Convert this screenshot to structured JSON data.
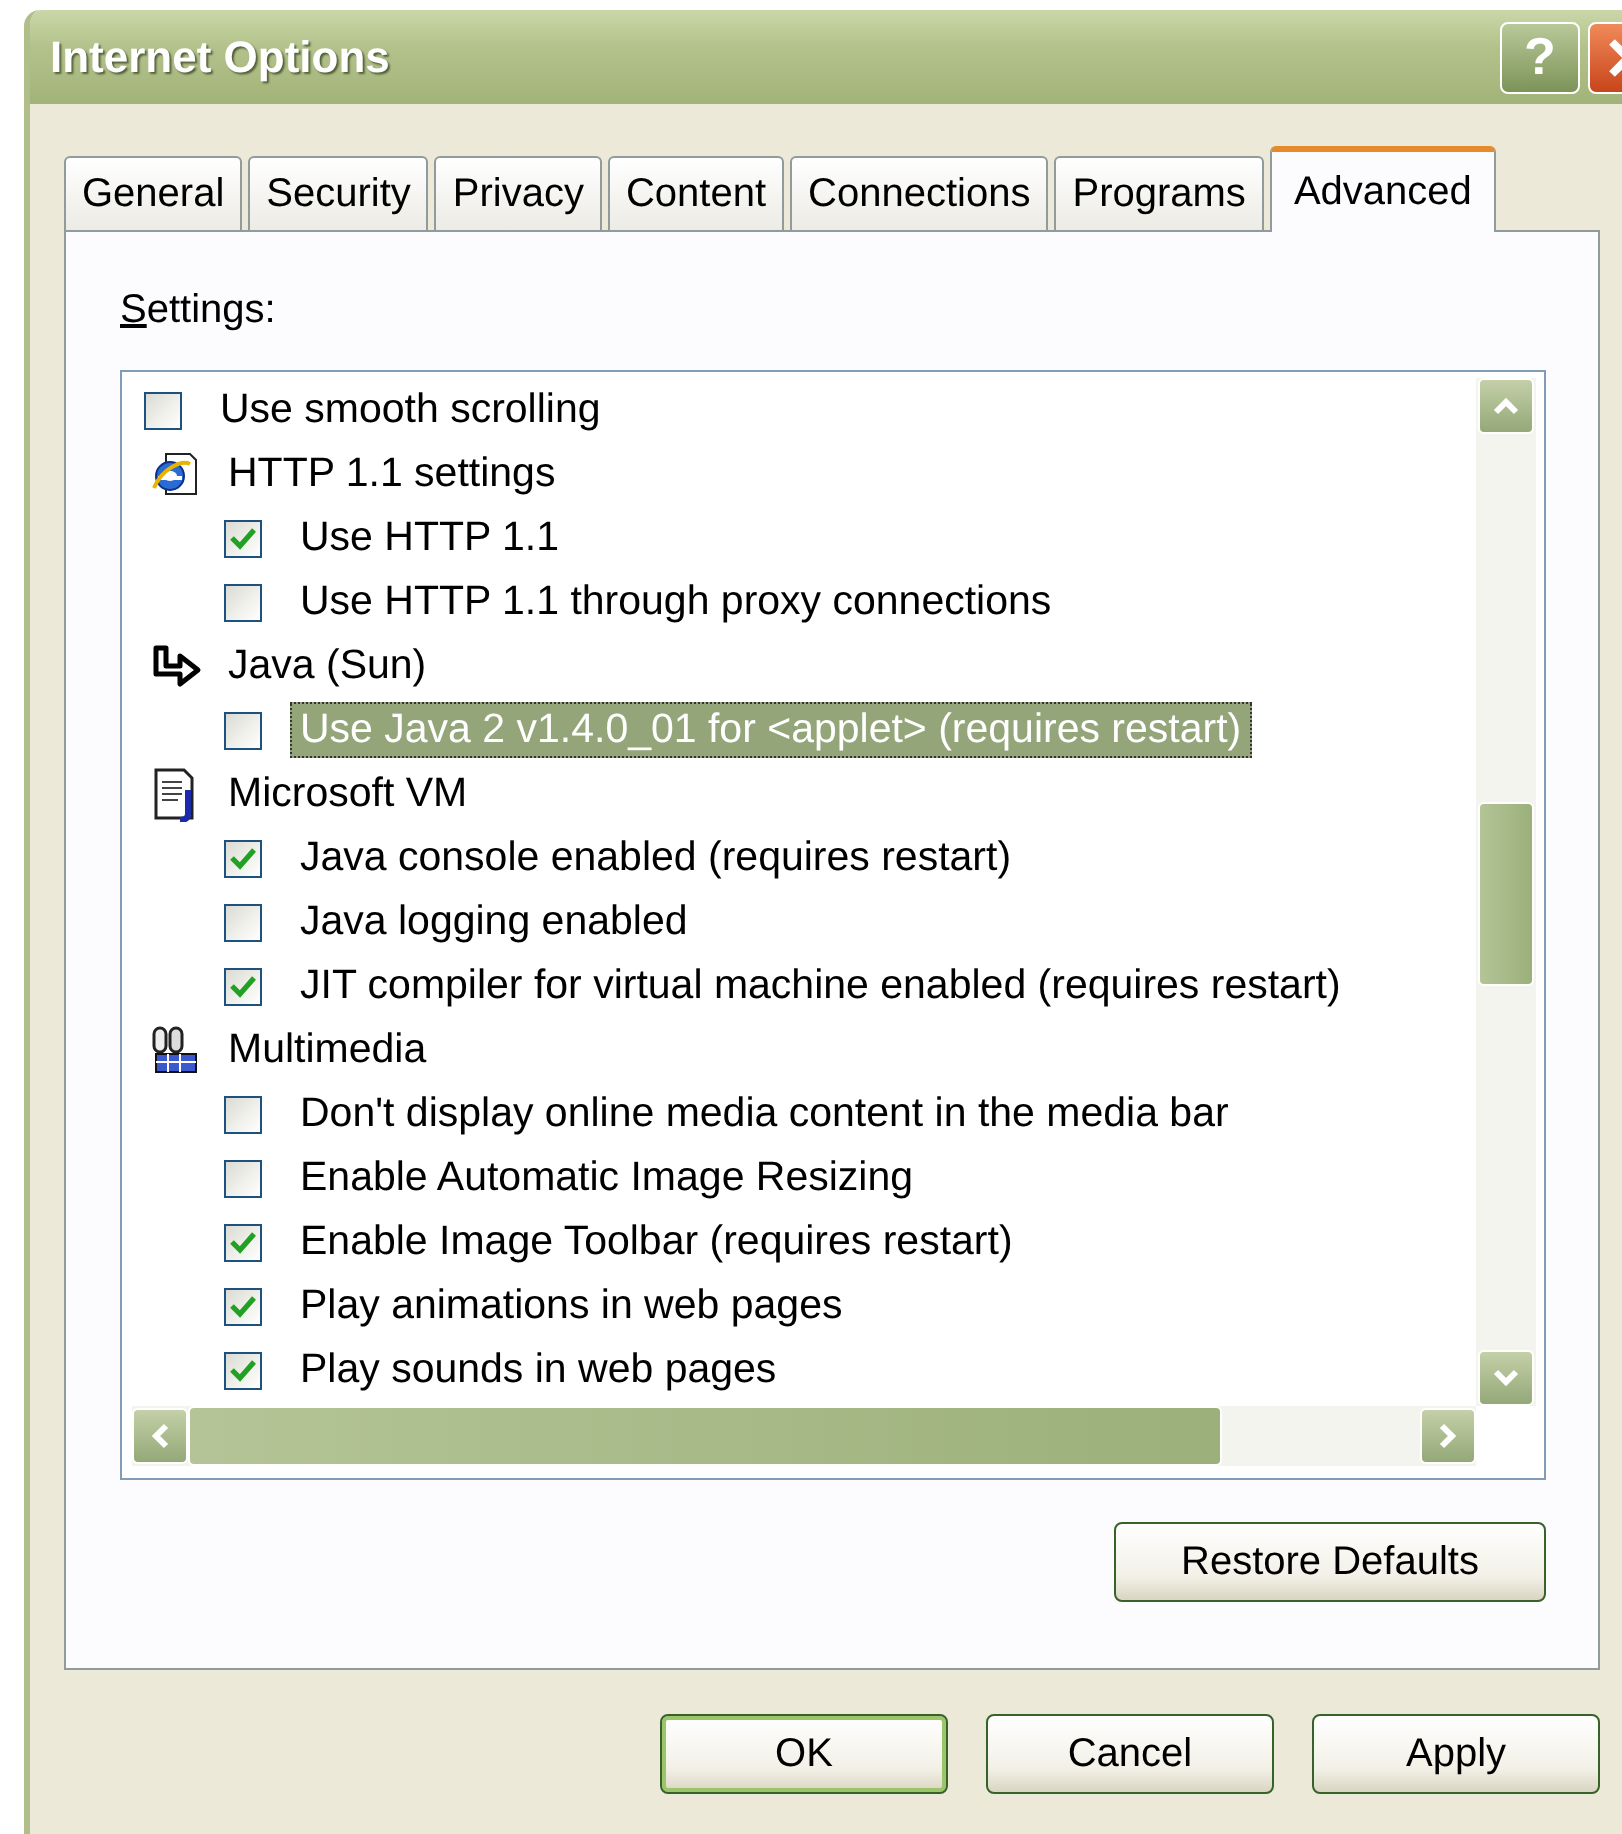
{
  "window": {
    "title": "Internet Options",
    "help_button": "?"
  },
  "tabs": [
    {
      "label": "General",
      "selected": false
    },
    {
      "label": "Security",
      "selected": false
    },
    {
      "label": "Privacy",
      "selected": false
    },
    {
      "label": "Content",
      "selected": false
    },
    {
      "label": "Connections",
      "selected": false
    },
    {
      "label": "Programs",
      "selected": false
    },
    {
      "label": "Advanced",
      "selected": true
    }
  ],
  "settings_label": "Settings:",
  "settings": [
    {
      "kind": "checkbox",
      "label": "Use smooth scrolling",
      "checked": false,
      "selected": false
    },
    {
      "kind": "group",
      "label": "HTTP 1.1 settings",
      "children": [
        {
          "kind": "checkbox",
          "label": "Use HTTP 1.1",
          "checked": true,
          "selected": false
        },
        {
          "kind": "checkbox",
          "label": "Use HTTP 1.1 through proxy connections",
          "checked": false,
          "selected": false
        }
      ]
    },
    {
      "kind": "group",
      "label": "Java (Sun)",
      "children": [
        {
          "kind": "checkbox",
          "label": "Use Java 2 v1.4.0_01 for <applet> (requires restart)",
          "checked": false,
          "selected": true
        }
      ]
    },
    {
      "kind": "group",
      "label": "Microsoft VM",
      "children": [
        {
          "kind": "checkbox",
          "label": "Java console enabled (requires restart)",
          "checked": true,
          "selected": false
        },
        {
          "kind": "checkbox",
          "label": "Java logging enabled",
          "checked": false,
          "selected": false
        },
        {
          "kind": "checkbox",
          "label": "JIT compiler for virtual machine enabled (requires restart)",
          "checked": true,
          "selected": false
        }
      ]
    },
    {
      "kind": "group",
      "label": "Multimedia",
      "children": [
        {
          "kind": "checkbox",
          "label": "Don't display online media content in the media bar",
          "checked": false,
          "selected": false
        },
        {
          "kind": "checkbox",
          "label": "Enable Automatic Image Resizing",
          "checked": false,
          "selected": false
        },
        {
          "kind": "checkbox",
          "label": "Enable Image Toolbar (requires restart)",
          "checked": true,
          "selected": false
        },
        {
          "kind": "checkbox",
          "label": "Play animations in web pages",
          "checked": true,
          "selected": false
        },
        {
          "kind": "checkbox",
          "label": "Play sounds in web pages",
          "checked": true,
          "selected": false
        }
      ]
    }
  ],
  "restore_button": "Restore Defaults",
  "buttons": [
    {
      "label": "OK",
      "default": true
    },
    {
      "label": "Cancel",
      "default": false
    },
    {
      "label": "Apply",
      "default": false
    }
  ]
}
